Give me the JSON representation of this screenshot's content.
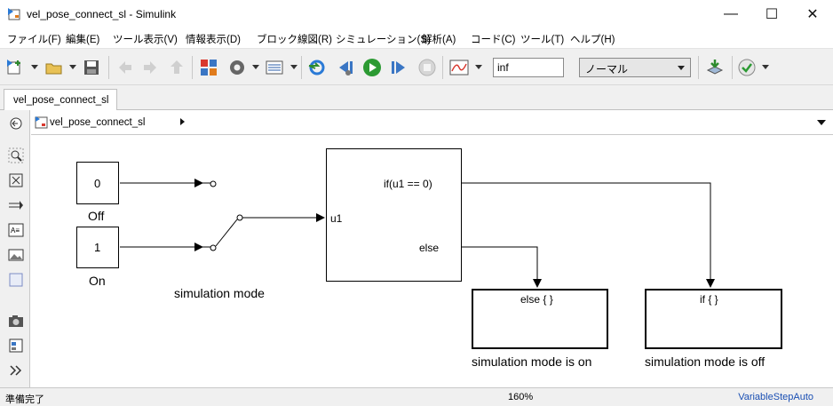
{
  "window": {
    "title": "vel_pose_connect_sl - Simulink",
    "minimize": "—",
    "maximize": "☐",
    "close": "✕"
  },
  "menu": [
    "ファイル(F)",
    "編集(E)",
    "ツール表示(V)",
    "情報表示(D)",
    "ブロック線図(R)",
    "シミュレーション(S)",
    "解析(A)",
    "コード(C)",
    "ツール(T)",
    "ヘルプ(H)"
  ],
  "toolbar": {
    "stop_time": "inf",
    "sim_mode": "ノーマル",
    "icons": [
      "new-model-icon",
      "open-icon",
      "save-icon",
      "back-icon",
      "forward-icon",
      "up-icon",
      "library-browser-icon",
      "model-settings-icon",
      "model-explorer-icon",
      "update-icon",
      "step-back-icon",
      "run-icon",
      "step-forward-icon",
      "stop-icon",
      "data-inspector-icon",
      "build-icon",
      "check-icon"
    ]
  },
  "tabs": [
    "vel_pose_connect_sl"
  ],
  "breadcrumb": {
    "model": "vel_pose_connect_sl"
  },
  "diagram": {
    "const_off_value": "0",
    "const_off_label": "Off",
    "const_on_value": "1",
    "const_on_label": "On",
    "switch_label": "simulation mode",
    "if_input": "u1",
    "if_condition": "if(u1 == 0)",
    "if_else": "else",
    "else_block_text": "else { }",
    "else_block_label": "simulation mode is on",
    "if_block_text": "if { }",
    "if_block_label": "simulation mode is off"
  },
  "status": {
    "state": "準備完了",
    "zoom": "160%",
    "solver": "VariableStepAuto"
  }
}
